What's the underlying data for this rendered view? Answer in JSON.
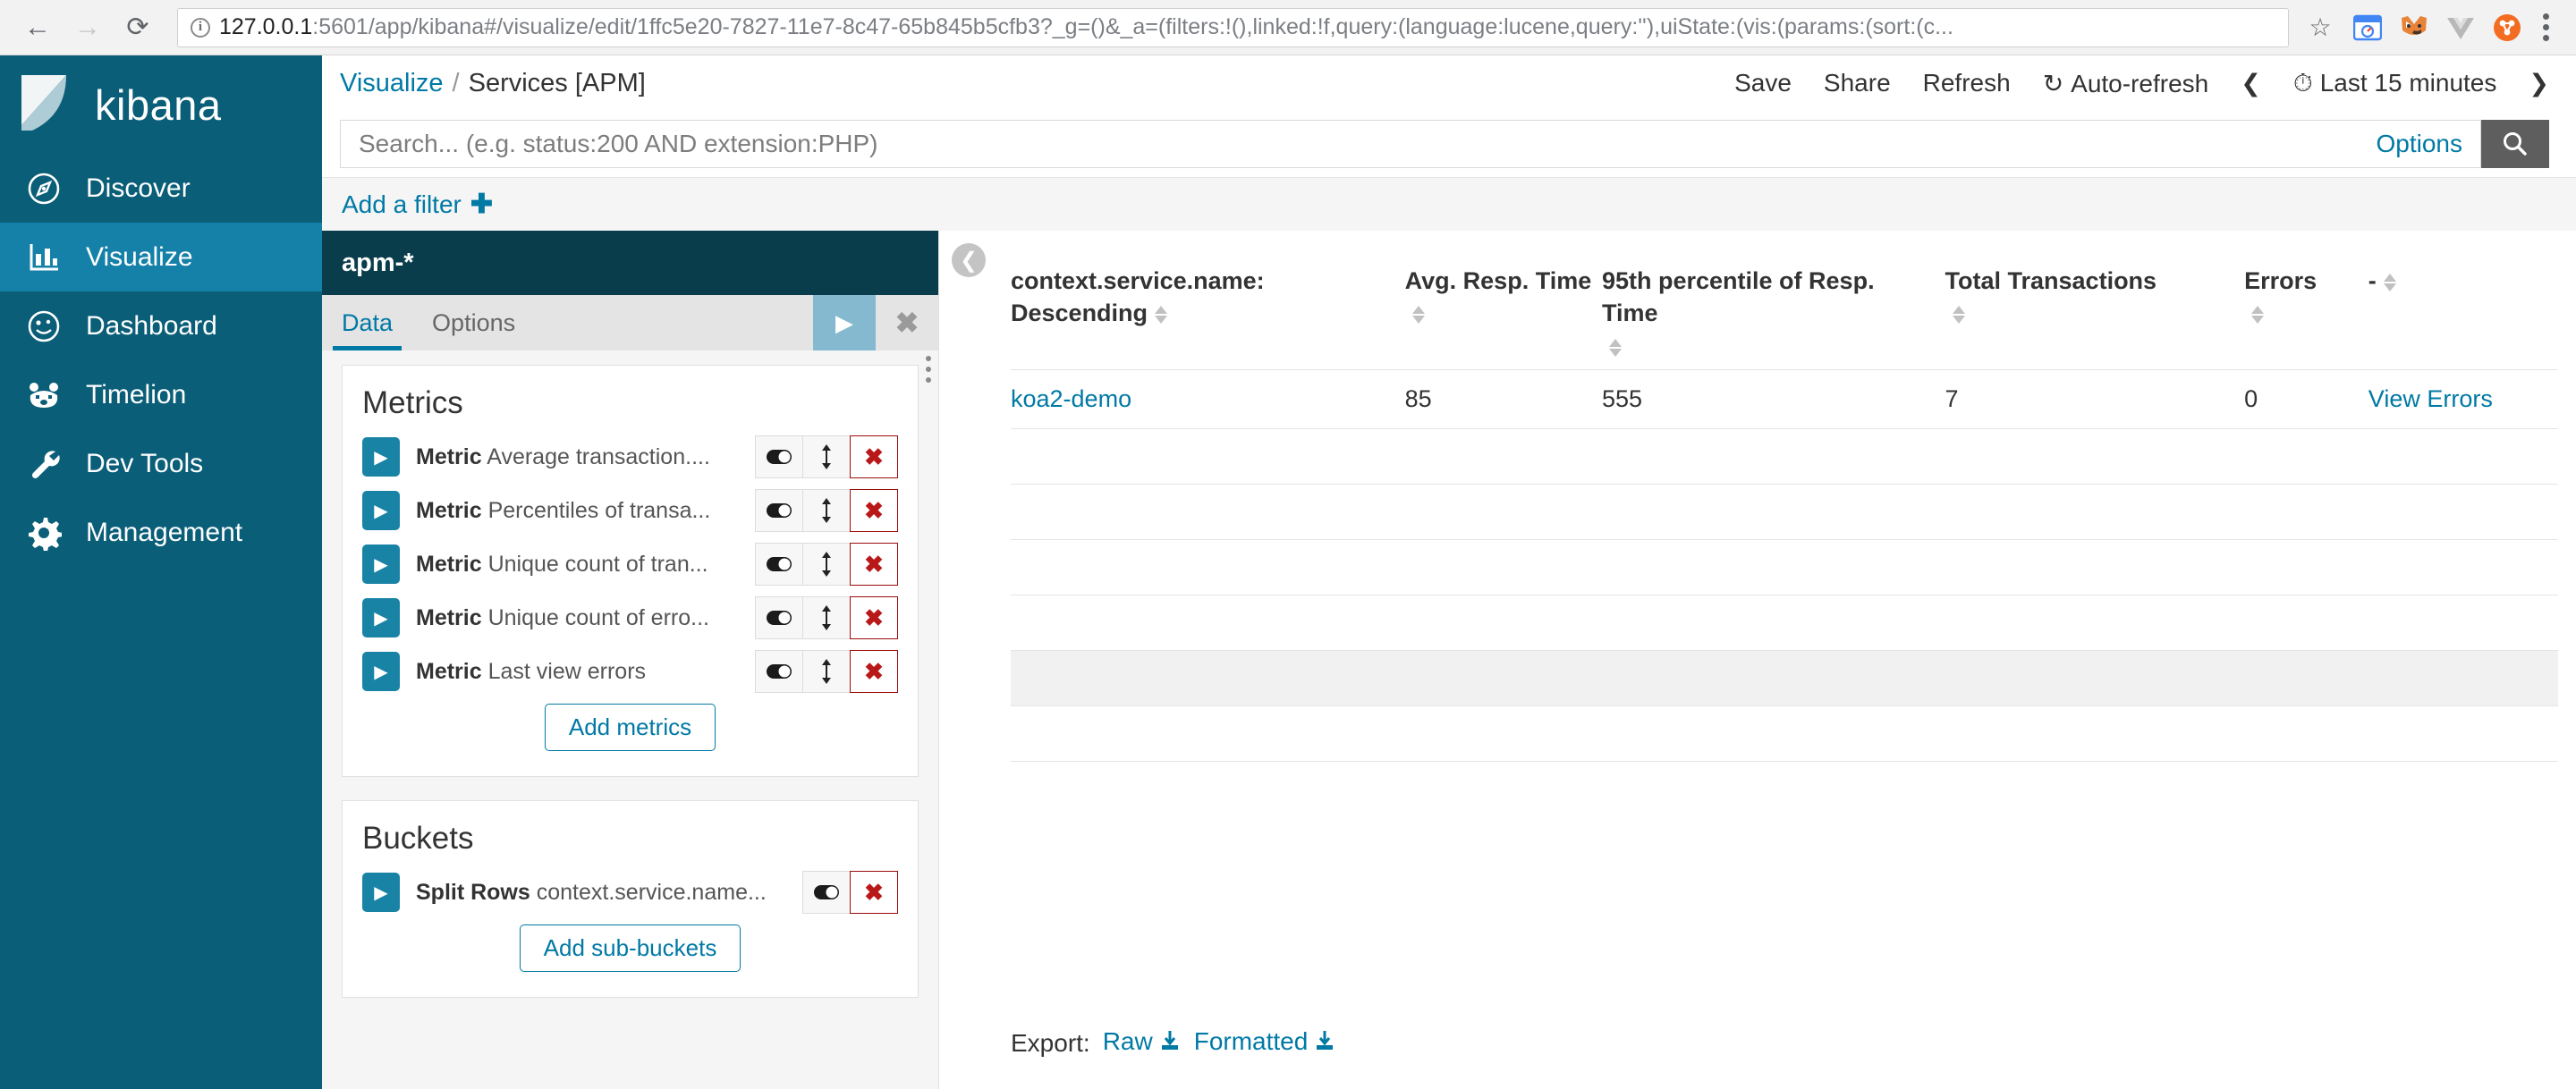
{
  "browser": {
    "back_icon": "back-arrow-icon",
    "forward_icon": "forward-arrow-icon",
    "reload_icon": "reload-icon",
    "url_host": "127.0.0.1",
    "url_rest": ":5601/app/kibana#/visualize/edit/1ffc5e20-7827-11e7-8c47-65b845b5cfb3?_g=()&_a=(filters:!(),linked:!f,query:(language:lucene,query:''),uiState:(vis:(params:(sort:(c...",
    "star_icon": "star-icon",
    "menu_icon": "kebab-menu-icon"
  },
  "sidebar": {
    "brand": "kibana",
    "items": [
      {
        "label": "Discover",
        "icon": "compass-icon",
        "active": false
      },
      {
        "label": "Visualize",
        "icon": "bar-chart-icon",
        "active": true
      },
      {
        "label": "Dashboard",
        "icon": "dashboard-icon",
        "active": false
      },
      {
        "label": "Timelion",
        "icon": "bear-icon",
        "active": false
      },
      {
        "label": "Dev Tools",
        "icon": "wrench-icon",
        "active": false
      },
      {
        "label": "Management",
        "icon": "gear-icon",
        "active": false
      }
    ]
  },
  "header": {
    "breadcrumb_root": "Visualize",
    "breadcrumb_sep": "/",
    "breadcrumb_current": "Services [APM]",
    "save": "Save",
    "share": "Share",
    "refresh": "Refresh",
    "auto_refresh": "Auto-refresh",
    "auto_refresh_icon": "refresh-cycle-icon",
    "time_range": "Last 15 minutes",
    "time_icon": "clock-icon",
    "prev_icon": "chevron-left-icon",
    "next_icon": "chevron-right-icon"
  },
  "search": {
    "value": "",
    "placeholder": "Search... (e.g. status:200 AND extension:PHP)",
    "options_label": "Options",
    "submit_icon": "search-icon"
  },
  "filters": {
    "add_filter_label": "Add a filter",
    "plus_icon": "plus-icon"
  },
  "config": {
    "index_pattern": "apm-*",
    "tabs": [
      {
        "label": "Data",
        "active": true
      },
      {
        "label": "Options",
        "active": false
      }
    ],
    "apply_icon": "play-apply-icon",
    "cancel_icon": "close-x-icon",
    "metrics": {
      "title": "Metrics",
      "rows": [
        {
          "type": "Metric",
          "desc": "Average transaction...."
        },
        {
          "type": "Metric",
          "desc": "Percentiles of transa..."
        },
        {
          "type": "Metric",
          "desc": "Unique count of tran..."
        },
        {
          "type": "Metric",
          "desc": "Unique count of erro..."
        },
        {
          "type": "Metric",
          "desc": "Last view errors"
        }
      ],
      "add_label": "Add metrics"
    },
    "buckets": {
      "title": "Buckets",
      "rows": [
        {
          "type": "Split Rows",
          "desc": "context.service.name..."
        }
      ],
      "add_label": "Add sub-buckets"
    },
    "toggle_icon": "visibility-toggle-icon",
    "move_icon": "move-updown-icon",
    "remove_icon": "remove-x-icon",
    "expand_icon": "chevron-right-icon"
  },
  "visualization": {
    "collapse_icon": "chevron-left-collapse-icon",
    "table": {
      "columns": [
        "context.service.name: Descending",
        "Avg. Resp. Time",
        "95th percentile of Resp. Time",
        "Total Transactions",
        "Errors",
        "-"
      ],
      "rows": [
        {
          "service": "koa2-demo",
          "avg_resp_time": "85",
          "p95_resp_time": "555",
          "total_transactions": "7",
          "errors": "0",
          "action": "View Errors"
        }
      ]
    },
    "export": {
      "label": "Export:",
      "raw": "Raw",
      "formatted": "Formatted",
      "download_icon": "download-icon"
    }
  },
  "colors": {
    "kibana_dark": "#0a5e78",
    "kibana_active": "#1580a8",
    "panel_header": "#0a3d4c",
    "link": "#0079a5",
    "danger": "#b81818"
  }
}
